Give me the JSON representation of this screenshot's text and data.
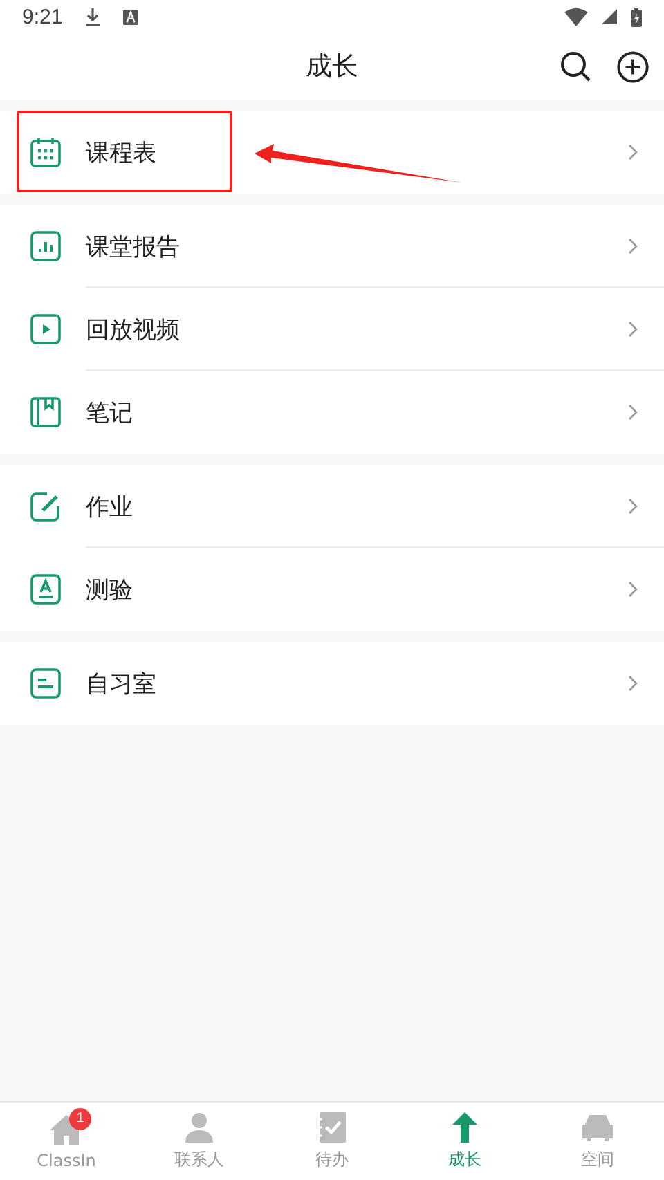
{
  "status_bar": {
    "time": "9:21"
  },
  "header": {
    "title": "成长"
  },
  "sections": [
    {
      "items": [
        {
          "label": "课程表",
          "kind": "calendar"
        }
      ]
    },
    {
      "items": [
        {
          "label": "课堂报告",
          "kind": "chart"
        },
        {
          "label": "回放视频",
          "kind": "play"
        },
        {
          "label": "笔记",
          "kind": "notebook"
        }
      ]
    },
    {
      "items": [
        {
          "label": "作业",
          "kind": "edit"
        },
        {
          "label": "测验",
          "kind": "quiz"
        }
      ]
    },
    {
      "items": [
        {
          "label": "自习室",
          "kind": "study"
        }
      ]
    }
  ],
  "tab_bar": [
    {
      "label": "ClassIn",
      "kind": "home",
      "badge": "1",
      "selected": false
    },
    {
      "label": "联系人",
      "kind": "person",
      "selected": false
    },
    {
      "label": "待办",
      "kind": "todo",
      "selected": false
    },
    {
      "label": "成长",
      "kind": "grow",
      "selected": true
    },
    {
      "label": "空间",
      "kind": "space",
      "selected": false
    }
  ]
}
